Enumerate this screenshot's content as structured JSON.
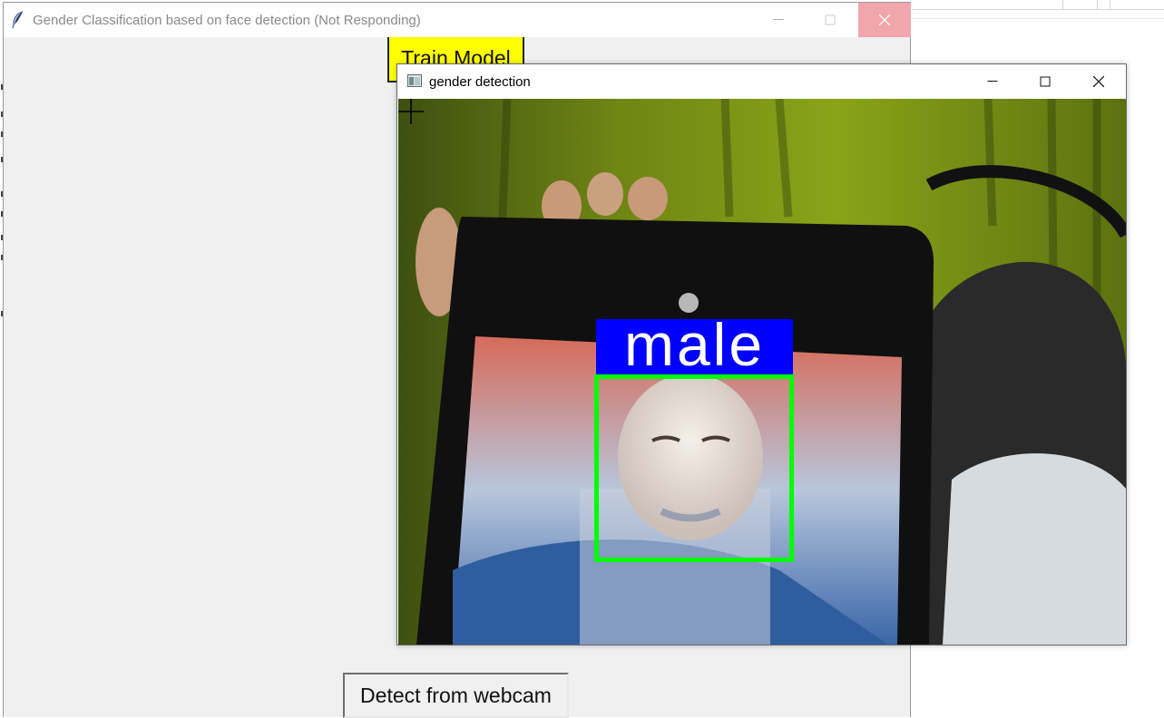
{
  "main_window": {
    "title": "Gender Classification based on face detection (Not Responding)",
    "train_button_label": "Train Model",
    "detect_webcam_button_label": "Detect from webcam"
  },
  "detection_window": {
    "title": "gender detection",
    "prediction_label": "male"
  },
  "colors": {
    "train_button_bg": "#ffff00",
    "label_bg": "#0000ff",
    "face_box": "#00ff00",
    "close_hover": "#f1a6ac"
  },
  "icons": [
    "feather-icon",
    "minimize-icon",
    "maximize-icon",
    "close-icon",
    "app-window-icon",
    "crosshair-cursor-icon"
  ]
}
